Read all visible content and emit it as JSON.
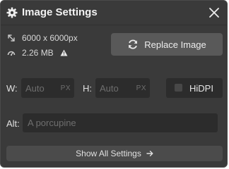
{
  "header": {
    "title": "Image Settings",
    "gear_icon": "gear-icon",
    "close_icon": "close-icon"
  },
  "meta": {
    "dimensions": "6000 x 6000px",
    "dimensions_icon": "resize-arrows-icon",
    "file_size": "2.26 MB",
    "file_size_icon": "gauge-icon",
    "warning_icon": "warning-icon"
  },
  "replace_button": {
    "label": "Replace Image",
    "icon": "refresh-icon"
  },
  "width_field": {
    "label": "W:",
    "value": "Auto",
    "unit": "PX"
  },
  "height_field": {
    "label": "H:",
    "value": "Auto",
    "unit": "PX"
  },
  "hidpi": {
    "label": "HiDPI",
    "checked": false
  },
  "alt_field": {
    "label": "Alt:",
    "placeholder": "A porcupine"
  },
  "footer_button": {
    "label": "Show All Settings",
    "icon": "arrow-right-icon"
  },
  "colors": {
    "panel_bg": "#3a3a3a",
    "input_bg": "#2c2c2c",
    "button_bg": "#595959",
    "text": "#e6e6e6",
    "placeholder": "#6e6e6e"
  }
}
